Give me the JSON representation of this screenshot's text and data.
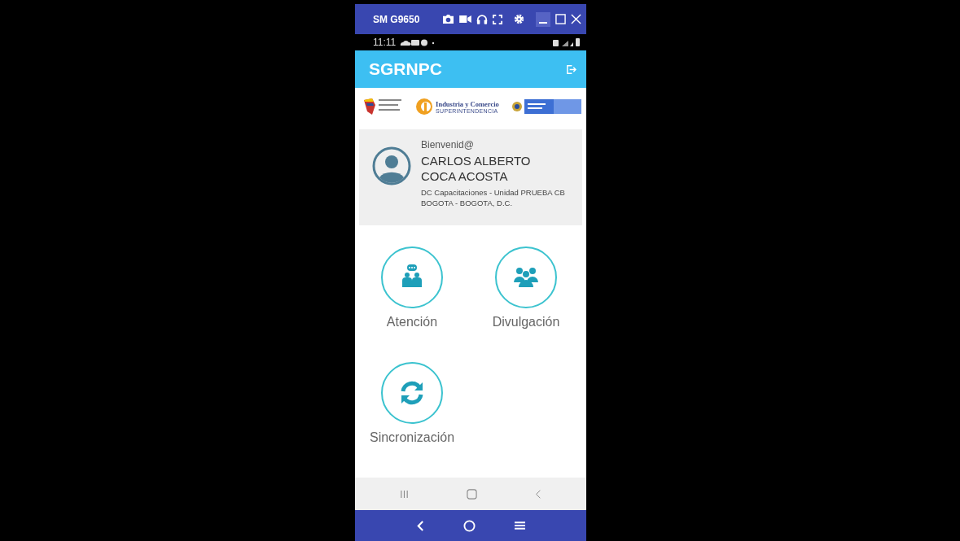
{
  "window": {
    "title": "SM G9650"
  },
  "status_bar": {
    "time": "11:11"
  },
  "app_bar": {
    "title": "SGRNPC"
  },
  "logos": {
    "sic_name": "Industria y Comercio",
    "sic_subtitle": "SUPERINTENDENCIA"
  },
  "profile": {
    "greeting": "Bienvenid@",
    "name": "CARLOS ALBERTO COCA ACOSTA",
    "unit": "DC Capacitaciones - Unidad PRUEBA CB",
    "location": "BOGOTA - BOGOTA, D.C."
  },
  "menu": [
    {
      "label": "Atención",
      "kind": "attention"
    },
    {
      "label": "Divulgación",
      "kind": "group"
    },
    {
      "label": "Sincronización",
      "kind": "sync"
    }
  ]
}
